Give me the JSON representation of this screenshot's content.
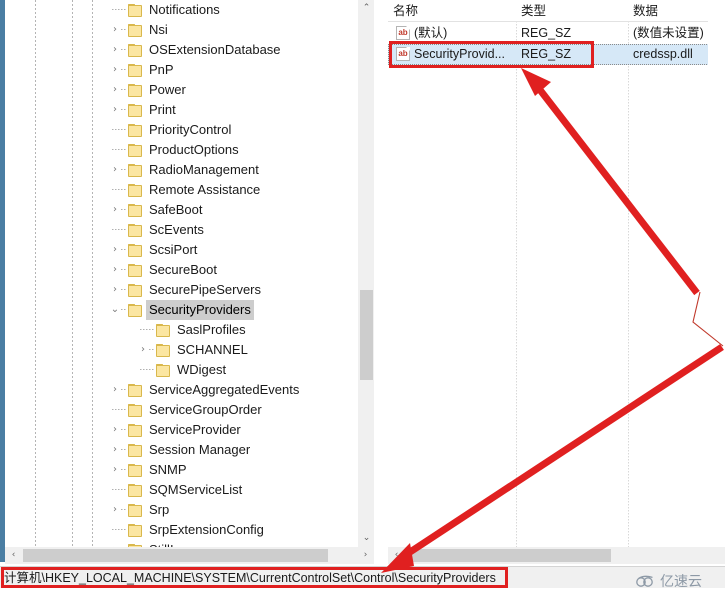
{
  "app": {
    "name": "registry-editor",
    "status_path": "计算机\\HKEY_LOCAL_MACHINE\\SYSTEM\\CurrentControlSet\\Control\\SecurityProviders"
  },
  "tree": {
    "scroll_up_glyph": "⌃",
    "scroll_down_glyph": "⌄",
    "scroll_left_glyph": "‹",
    "scroll_right_glyph": "›",
    "expanded_glyph": "⌄",
    "collapsed_glyph": "›",
    "items": [
      {
        "label": "Notifications",
        "depth": 1,
        "state": "leaf",
        "selected": false
      },
      {
        "label": "Nsi",
        "depth": 1,
        "state": "collapsed",
        "selected": false
      },
      {
        "label": "OSExtensionDatabase",
        "depth": 1,
        "state": "collapsed",
        "selected": false
      },
      {
        "label": "PnP",
        "depth": 1,
        "state": "collapsed",
        "selected": false
      },
      {
        "label": "Power",
        "depth": 1,
        "state": "collapsed",
        "selected": false
      },
      {
        "label": "Print",
        "depth": 1,
        "state": "collapsed",
        "selected": false
      },
      {
        "label": "PriorityControl",
        "depth": 1,
        "state": "leaf",
        "selected": false
      },
      {
        "label": "ProductOptions",
        "depth": 1,
        "state": "leaf",
        "selected": false
      },
      {
        "label": "RadioManagement",
        "depth": 1,
        "state": "collapsed",
        "selected": false
      },
      {
        "label": "Remote Assistance",
        "depth": 1,
        "state": "leaf",
        "selected": false
      },
      {
        "label": "SafeBoot",
        "depth": 1,
        "state": "collapsed",
        "selected": false
      },
      {
        "label": "ScEvents",
        "depth": 1,
        "state": "leaf",
        "selected": false
      },
      {
        "label": "ScsiPort",
        "depth": 1,
        "state": "collapsed",
        "selected": false
      },
      {
        "label": "SecureBoot",
        "depth": 1,
        "state": "collapsed",
        "selected": false
      },
      {
        "label": "SecurePipeServers",
        "depth": 1,
        "state": "collapsed",
        "selected": false
      },
      {
        "label": "SecurityProviders",
        "depth": 1,
        "state": "expanded",
        "selected": true
      },
      {
        "label": "SaslProfiles",
        "depth": 2,
        "state": "leaf",
        "selected": false
      },
      {
        "label": "SCHANNEL",
        "depth": 2,
        "state": "collapsed",
        "selected": false
      },
      {
        "label": "WDigest",
        "depth": 2,
        "state": "leaf",
        "selected": false
      },
      {
        "label": "ServiceAggregatedEvents",
        "depth": 1,
        "state": "collapsed",
        "selected": false
      },
      {
        "label": "ServiceGroupOrder",
        "depth": 1,
        "state": "leaf",
        "selected": false
      },
      {
        "label": "ServiceProvider",
        "depth": 1,
        "state": "collapsed",
        "selected": false
      },
      {
        "label": "Session Manager",
        "depth": 1,
        "state": "collapsed",
        "selected": false
      },
      {
        "label": "SNMP",
        "depth": 1,
        "state": "collapsed",
        "selected": false
      },
      {
        "label": "SQMServiceList",
        "depth": 1,
        "state": "leaf",
        "selected": false
      },
      {
        "label": "Srp",
        "depth": 1,
        "state": "collapsed",
        "selected": false
      },
      {
        "label": "SrpExtensionConfig",
        "depth": 1,
        "state": "leaf",
        "selected": false
      },
      {
        "label": "StillImage",
        "depth": 1,
        "state": "collapsed",
        "selected": false
      }
    ]
  },
  "values": {
    "columns": [
      {
        "key": "name",
        "label": "名称"
      },
      {
        "key": "type",
        "label": "类型"
      },
      {
        "key": "data",
        "label": "数据"
      }
    ],
    "rows": [
      {
        "icon": "string-value-icon",
        "name": "(默认)",
        "type": "REG_SZ",
        "data": "(数值未设置)",
        "selected": false
      },
      {
        "icon": "string-value-icon",
        "name": "SecurityProvid...",
        "type": "REG_SZ",
        "data": "credssp.dll",
        "selected": true
      }
    ],
    "icon_text": "ab"
  },
  "annotations": {
    "highlight_color": "#e02020",
    "boxes": [
      {
        "name": "value-row-highlight-box"
      },
      {
        "name": "status-path-highlight-box"
      }
    ],
    "arrows": [
      {
        "name": "arrow-to-value-row"
      },
      {
        "name": "arrow-to-status-path"
      }
    ]
  },
  "watermark": {
    "text": "亿速云"
  }
}
